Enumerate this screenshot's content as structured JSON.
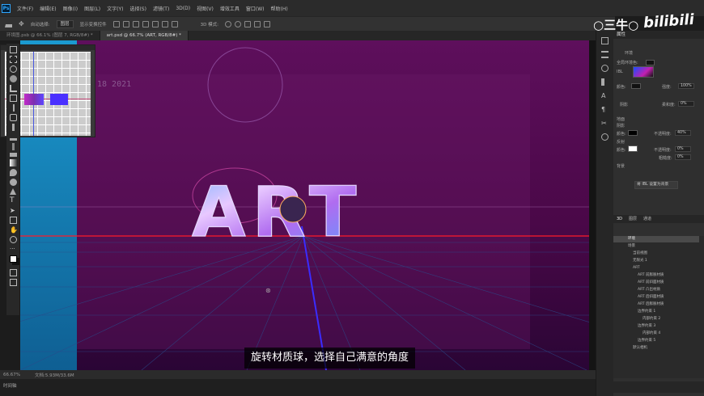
{
  "app": {
    "logo_text": "Ps"
  },
  "menu": [
    "文件(F)",
    "编辑(E)",
    "图像(I)",
    "图层(L)",
    "文字(Y)",
    "选择(S)",
    "滤镜(T)",
    "3D(D)",
    "视图(V)",
    "增效工具",
    "窗口(W)",
    "帮助(H)"
  ],
  "options": {
    "auto_select": "自动选择:",
    "auto_select_value": "图层",
    "transform": "显示变换控件",
    "mode_3d": "3D 模式:"
  },
  "tabs": [
    {
      "label": "环境图.psb @ 66.1% (图层 7, RGB/8#) *"
    },
    {
      "label": "art.psd @ 66.7% (ART, RGB/8#) *"
    }
  ],
  "canvas": {
    "art_text": "ART",
    "year_text": "18 2021",
    "colors": {
      "bg": "#5a0a56",
      "grid": "#ff1a2a",
      "accent": "#31a8ff"
    }
  },
  "status": {
    "zoom": "66.67%",
    "doc": "文档:5.93M/33.6M"
  },
  "timeline": {
    "label": "时间轴"
  },
  "watermark": {
    "text": "○三牛○",
    "brand": "bilibili"
  },
  "subtitle": {
    "text": "旋转材质球，选择自己满意的角度"
  },
  "properties": {
    "title": "属性",
    "tab": "环境",
    "global_env_color": "全局环境色:",
    "ibl": "IBL",
    "color": "颜色:",
    "intensity": "强度:",
    "intensity_value": "100%",
    "shadow": "阴影",
    "softness": "柔和度:",
    "softness_value": "0%",
    "ground": "地面",
    "ground_shadow": "阴影",
    "opacity": "不透明度:",
    "opacity_value": "40%",
    "reflection": "反射",
    "ref_opacity_value": "0%",
    "roughness": "粗糙度:",
    "roughness_value": "0%",
    "background": "背景",
    "set_bg_button": "将 IBL 设置为背景"
  },
  "layers": {
    "tabs": [
      "3D",
      "图层",
      "通道"
    ],
    "items": [
      {
        "label": "环境",
        "selected": true
      },
      {
        "label": "场景",
        "selected": false
      },
      {
        "label": "当前视图",
        "selected": false
      },
      {
        "label": "无限光 1",
        "selected": false
      },
      {
        "label": "ART",
        "selected": false
      },
      {
        "label": "ART 前膨胀材质",
        "selected": false
      },
      {
        "label": "ART 前斜面材质",
        "selected": false
      },
      {
        "label": "ART 凸出材质",
        "selected": false
      },
      {
        "label": "ART 后斜面材质",
        "selected": false
      },
      {
        "label": "ART 后膨胀材质",
        "selected": false
      },
      {
        "label": "边界约束 1",
        "selected": false
      },
      {
        "label": "内部约束 2",
        "selected": false
      },
      {
        "label": "边界约束 3",
        "selected": false
      },
      {
        "label": "内部约束 4",
        "selected": false
      },
      {
        "label": "边界约束 5",
        "selected": false
      },
      {
        "label": "默认相机",
        "selected": false
      }
    ]
  }
}
